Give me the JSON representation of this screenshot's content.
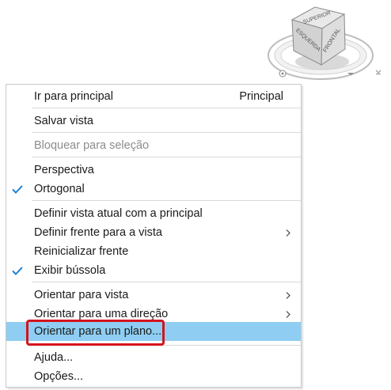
{
  "viewcube": {
    "top_label": "SUPERIOR",
    "left_label": "ESQUERDA",
    "front_label": "FRONTAL"
  },
  "menu": {
    "items": [
      {
        "label": "Ir para principal",
        "shortcut": "Principal"
      },
      {
        "label": "Salvar vista"
      },
      {
        "label": "Bloquear para seleção",
        "disabled": true
      },
      {
        "label": "Perspectiva"
      },
      {
        "label": "Ortogonal",
        "checked": true
      },
      {
        "label": "Definir vista atual com a principal"
      },
      {
        "label": "Definir frente para a vista",
        "submenu": true
      },
      {
        "label": "Reinicializar frente"
      },
      {
        "label": "Exibir bússola",
        "checked": true
      },
      {
        "label": "Orientar para vista",
        "submenu": true
      },
      {
        "label": "Orientar para uma direção",
        "submenu": true
      },
      {
        "label": "Orientar para um plano...",
        "highlighted": true
      },
      {
        "label": "Ajuda..."
      },
      {
        "label": "Opções..."
      }
    ]
  },
  "colors": {
    "highlight": "#8fcef2",
    "annotation": "#d4141c",
    "check": "#1a7fd4"
  },
  "icons": {
    "check": "check-icon",
    "submenu": "chevron-right-icon"
  }
}
